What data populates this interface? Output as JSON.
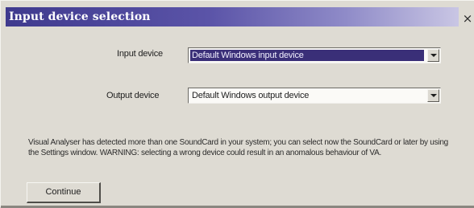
{
  "window": {
    "title": "Input device selection",
    "close_glyph": "×"
  },
  "input_device": {
    "label": "Input device",
    "value": "Default Windows input device"
  },
  "output_device": {
    "label": "Output device",
    "value": "Default Windows output device"
  },
  "message": "Visual Analyser has detected more than one SoundCard in your system; you can select now the SoundCard or later by using the Settings window. WARNING: selecting a wrong device could result in an anomalous behaviour of VA.",
  "actions": {
    "continue_label": "Continue"
  },
  "colors": {
    "titlebar_start": "#3f3a8e",
    "titlebar_end": "#c9c6e4",
    "selection": "#3a2f78",
    "dialog_bg": "#dedbd3"
  },
  "icons": {
    "close": "close-icon",
    "dropdown": "chevron-down-icon"
  }
}
